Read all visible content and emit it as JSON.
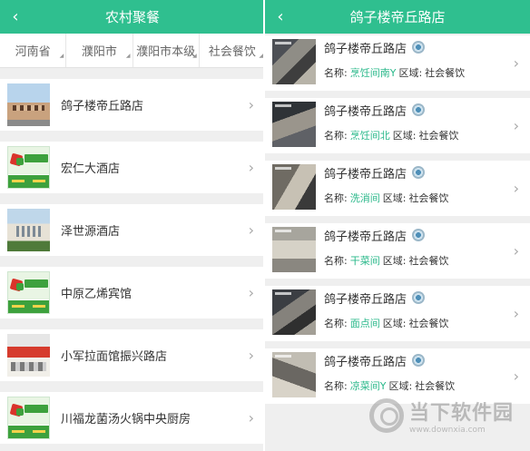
{
  "left": {
    "back_icon": "chevron-left-icon",
    "title": "农村聚餐",
    "filters": [
      "河南省",
      "濮阳市",
      "濮阳市本级",
      "社会餐饮"
    ],
    "restaurants": [
      {
        "name": "鸽子楼帝丘路店",
        "thumb": "building"
      },
      {
        "name": "宏仁大酒店",
        "thumb": "green"
      },
      {
        "name": "泽世源酒店",
        "thumb": "hotel"
      },
      {
        "name": "中原乙烯宾馆",
        "thumb": "green"
      },
      {
        "name": "小军拉面馆振兴路店",
        "thumb": "shop"
      },
      {
        "name": "川福龙菌汤火锅中央厨房",
        "thumb": "green"
      }
    ]
  },
  "right": {
    "back_icon": "chevron-left-icon",
    "title": "鸽子楼帝丘路店",
    "name_prefix": "名称:",
    "area_prefix": "区域:",
    "cameras": [
      {
        "name": "鸽子楼帝丘路店",
        "location": "烹饪间南Y",
        "area": "社会餐饮"
      },
      {
        "name": "鸽子楼帝丘路店",
        "location": "烹饪间北",
        "area": "社会餐饮"
      },
      {
        "name": "鸽子楼帝丘路店",
        "location": "洗消间",
        "area": "社会餐饮"
      },
      {
        "name": "鸽子楼帝丘路店",
        "location": "干菜间",
        "area": "社会餐饮"
      },
      {
        "name": "鸽子楼帝丘路店",
        "location": "面点间",
        "area": "社会餐饮"
      },
      {
        "name": "鸽子楼帝丘路店",
        "location": "凉菜间Y",
        "area": "社会餐饮"
      }
    ]
  },
  "watermark": {
    "title": "当下软件园",
    "url": "www.downxia.com"
  },
  "colors": {
    "header": "#2fbf8f",
    "location_text": "#29b88a",
    "background": "#efefef"
  }
}
